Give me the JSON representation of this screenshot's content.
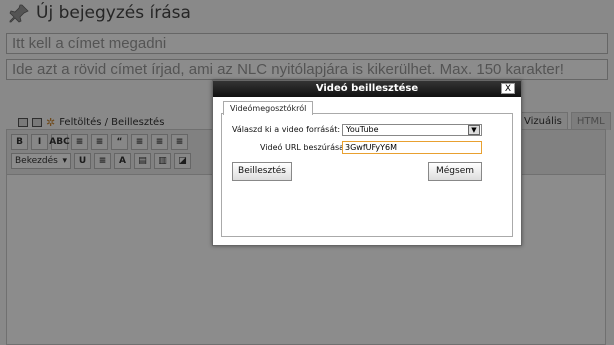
{
  "page": {
    "title": "Új bejegyzés írása",
    "title_placeholder": "Itt kell a címet megadni",
    "subtitle_placeholder": "Ide azt a rövid címet írjad, ami az NLC nyitólapjára is kikerülhet. Max. 150 karakter!",
    "media_label": "Feltöltés / Beillesztés"
  },
  "editor": {
    "tabs": [
      {
        "label": "Vizuális"
      },
      {
        "label": "HTML"
      }
    ],
    "toolbar_row1": [
      "B",
      "I",
      "ABC",
      "≡",
      "≡",
      "“",
      "≡",
      "≡",
      "≡"
    ],
    "format_select": "Bekezdés",
    "toolbar_row2": [
      "U",
      "≡",
      "A"
    ]
  },
  "dialog": {
    "title": "Videó beillesztése",
    "close_label": "X",
    "tab_label": "Videómegosztókról",
    "source_label": "Válaszd ki a video forrását:",
    "source_value": "YouTube",
    "url_label": "Videó URL beszúrása:",
    "url_value": "3GwfUFyY6M",
    "insert_label": "Beillesztés",
    "cancel_label": "Mégsem"
  }
}
